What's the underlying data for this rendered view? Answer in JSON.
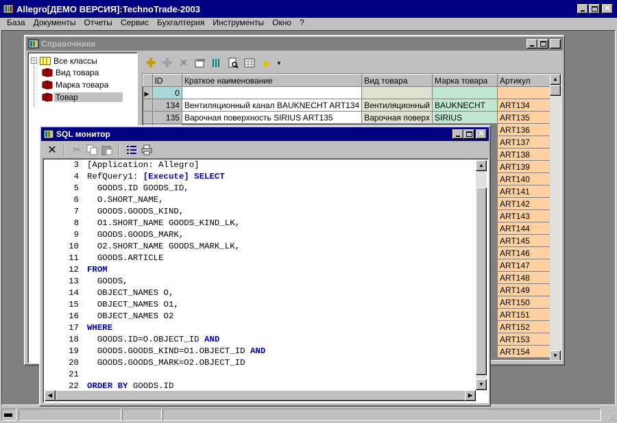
{
  "app": {
    "title": "Allegro[ДЕМО ВЕРСИЯ]:TechnoTrade-2003",
    "menu": [
      "База",
      "Документы",
      "Отчеты",
      "Сервис",
      "Бухгалтерия",
      "Инструменты",
      "Окно",
      "?"
    ]
  },
  "ref_window": {
    "title": "Справочники",
    "tree": {
      "root": "Все классы",
      "children": [
        "Вид товара",
        "Марка товара",
        "Товар"
      ],
      "selected": "Товар"
    },
    "toolbar_icons": [
      "add-icon",
      "add-copy-icon",
      "delete-icon",
      "edit-icon",
      "columns-icon",
      "preview-icon",
      "grid-icon",
      "filter-icon",
      "dropdown-arrow-icon"
    ],
    "grid": {
      "columns": [
        "ID",
        "Краткое наименование",
        "Вид товара",
        "Марка товара",
        "Артикул"
      ],
      "rows": [
        {
          "id": "0",
          "name": "",
          "kind": "",
          "mark": "",
          "article": ""
        },
        {
          "id": "134",
          "name": "Вентиляционный канал BAUKNECHT ART134",
          "kind": "Вентиляционный",
          "mark": "BAUKNECHT",
          "article": "ART134"
        },
        {
          "id": "135",
          "name": "Варочная поверхность SIRIUS ART135",
          "kind": "Варочная поверх",
          "mark": "SIRIUS",
          "article": "ART135"
        },
        {
          "id": "",
          "name": "",
          "kind": "",
          "mark": "",
          "article": "ART136"
        },
        {
          "id": "",
          "name": "",
          "kind": "",
          "mark": "",
          "article": "ART137"
        },
        {
          "id": "",
          "name": "",
          "kind": "",
          "mark": "",
          "article": "ART138"
        },
        {
          "id": "",
          "name": "",
          "kind": "",
          "mark": "",
          "article": "ART139"
        },
        {
          "id": "",
          "name": "",
          "kind": "",
          "mark": "",
          "article": "ART140"
        },
        {
          "id": "",
          "name": "",
          "kind": "",
          "mark": "",
          "article": "ART141"
        },
        {
          "id": "",
          "name": "",
          "kind": "",
          "mark": "",
          "article": "ART142"
        },
        {
          "id": "",
          "name": "",
          "kind": "",
          "mark": "",
          "article": "ART143"
        },
        {
          "id": "",
          "name": "",
          "kind": "",
          "mark": "",
          "article": "ART144"
        },
        {
          "id": "",
          "name": "",
          "kind": "",
          "mark": "",
          "article": "ART145"
        },
        {
          "id": "",
          "name": "",
          "kind": "",
          "mark": "",
          "article": "ART146"
        },
        {
          "id": "",
          "name": "",
          "kind": "",
          "mark": "",
          "article": "ART147"
        },
        {
          "id": "",
          "name": "",
          "kind": "",
          "mark": "",
          "article": "ART148"
        },
        {
          "id": "",
          "name": "",
          "kind": "",
          "mark": "",
          "article": "ART149"
        },
        {
          "id": "",
          "name": "",
          "kind": "",
          "mark": "",
          "article": "ART150"
        },
        {
          "id": "",
          "name": "",
          "kind": "",
          "mark": "",
          "article": "ART151"
        },
        {
          "id": "",
          "name": "",
          "kind": "",
          "mark": "",
          "article": "ART152"
        },
        {
          "id": "",
          "name": "",
          "kind": "",
          "mark": "",
          "article": "ART153"
        },
        {
          "id": "",
          "name": "",
          "kind": "",
          "mark": "",
          "article": "ART154"
        }
      ],
      "colors": {
        "id_new": "#a8d8d8",
        "kind": "#e0e0d0",
        "mark": "#c0e8d0",
        "article": "#ffd0a0"
      }
    }
  },
  "sql_window": {
    "title": "SQL монитор",
    "toolbar_icons": [
      "close-x-icon",
      "cut-icon",
      "copy-icon",
      "paste-icon",
      "list-icon",
      "print-icon"
    ],
    "lines": [
      {
        "n": "3",
        "parts": [
          {
            "t": "[Application: Allegro]"
          }
        ]
      },
      {
        "n": "4",
        "parts": [
          {
            "t": "RefQuery1: "
          },
          {
            "t": "[Execute]",
            "kw": true
          },
          {
            "t": " "
          },
          {
            "t": "SELECT",
            "kw": true
          }
        ]
      },
      {
        "n": "5",
        "parts": [
          {
            "t": "  GOODS.ID GOODS_ID,"
          }
        ]
      },
      {
        "n": "6",
        "parts": [
          {
            "t": "  O.SHORT_NAME,"
          }
        ]
      },
      {
        "n": "7",
        "parts": [
          {
            "t": "  GOODS.GOODS_KIND,"
          }
        ]
      },
      {
        "n": "8",
        "parts": [
          {
            "t": "  O1.SHORT_NAME GOODS_KIND_LK,"
          }
        ]
      },
      {
        "n": "9",
        "parts": [
          {
            "t": "  GOODS.GOODS_MARK,"
          }
        ]
      },
      {
        "n": "10",
        "parts": [
          {
            "t": "  O2.SHORT_NAME GOODS_MARK_LK,"
          }
        ]
      },
      {
        "n": "11",
        "parts": [
          {
            "t": "  GOODS.ARTICLE"
          }
        ]
      },
      {
        "n": "12",
        "parts": [
          {
            "t": "FROM",
            "kw": true
          }
        ]
      },
      {
        "n": "13",
        "parts": [
          {
            "t": "  GOODS,"
          }
        ]
      },
      {
        "n": "14",
        "parts": [
          {
            "t": "  OBJECT_NAMES O,"
          }
        ]
      },
      {
        "n": "15",
        "parts": [
          {
            "t": "  OBJECT_NAMES O1,"
          }
        ]
      },
      {
        "n": "16",
        "parts": [
          {
            "t": "  OBJECT_NAMES O2"
          }
        ]
      },
      {
        "n": "17",
        "parts": [
          {
            "t": "WHERE",
            "kw": true
          }
        ]
      },
      {
        "n": "18",
        "parts": [
          {
            "t": "  GOODS.ID=O.OBJECT_ID "
          },
          {
            "t": "AND",
            "kw": true
          }
        ]
      },
      {
        "n": "19",
        "parts": [
          {
            "t": "  GOODS.GOODS_KIND=O1.OBJECT_ID "
          },
          {
            "t": "AND",
            "kw": true
          }
        ]
      },
      {
        "n": "20",
        "parts": [
          {
            "t": "  GOODS.GOODS_MARK=O2.OBJECT_ID"
          }
        ]
      },
      {
        "n": "21",
        "parts": [
          {
            "t": ""
          }
        ]
      },
      {
        "n": "22",
        "parts": [
          {
            "t": "ORDER BY",
            "kw": true
          },
          {
            "t": " GOODS.ID"
          }
        ]
      }
    ]
  }
}
